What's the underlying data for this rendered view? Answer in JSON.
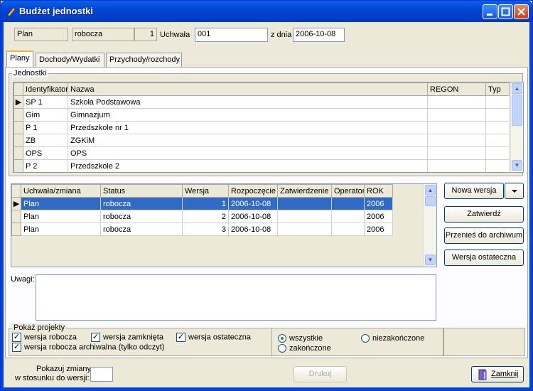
{
  "window": {
    "title": "Budżet jednostki"
  },
  "header": {
    "plan": "Plan",
    "state": "robocza",
    "version": "1",
    "uchwala_label": "Uchwała",
    "uchwala_value": "001",
    "date_label": "z dnia",
    "date_value": "2006-10-08"
  },
  "tabs": [
    "Plany",
    "Dochody/Wydatki",
    "Przychody/rozchody"
  ],
  "units": {
    "group_label": "Jednostki",
    "columns": [
      "Identyfikator",
      "Nazwa",
      "REGON",
      "Typ"
    ],
    "rows": [
      {
        "id": "SP 1",
        "name": "Szkoła Podstawowa",
        "regon": "",
        "typ": ""
      },
      {
        "id": "Gim",
        "name": "Gimnazjum",
        "regon": "",
        "typ": ""
      },
      {
        "id": "P 1",
        "name": "Przedszkole nr 1",
        "regon": "",
        "typ": ""
      },
      {
        "id": "ZB",
        "name": "ZGKiM",
        "regon": "",
        "typ": ""
      },
      {
        "id": "OPS",
        "name": "OPS",
        "regon": "",
        "typ": ""
      },
      {
        "id": "P 2",
        "name": "Przedszkole 2",
        "regon": "",
        "typ": ""
      }
    ]
  },
  "versions": {
    "columns": [
      "Uchwała/zmiana",
      "Status",
      "Wersja",
      "Rozpoczęcie",
      "Zatwierdzenie",
      "Operator",
      "ROK"
    ],
    "rows": [
      {
        "uchwala": "Plan",
        "status": "robocza",
        "wersja": "1",
        "start": "2006-10-08",
        "approved": "",
        "operator": "",
        "rok": "2006"
      },
      {
        "uchwala": "Plan",
        "status": "robocza",
        "wersja": "2",
        "start": "2006-10-08",
        "approved": "",
        "operator": "",
        "rok": "2006"
      },
      {
        "uchwala": "Plan",
        "status": "robocza",
        "wersja": "3",
        "start": "2006-10-08",
        "approved": "",
        "operator": "",
        "rok": "2006"
      }
    ]
  },
  "buttons": {
    "new_version": "Nowa wersja",
    "approve": "Zatwierdź",
    "archive": "Przenieś do archiwum",
    "final": "Wersja ostateczna",
    "print": "Drukuj",
    "close": "Zamknij"
  },
  "notes": {
    "label": "Uwagi:",
    "value": ""
  },
  "filters": {
    "group_label": "Pokaż projekty",
    "checkboxes": [
      {
        "label": "wersja robocza",
        "checked": true
      },
      {
        "label": "wersja zamknięta",
        "checked": true
      },
      {
        "label": "wersja ostateczna",
        "checked": true
      },
      {
        "label": "wersja robocza archiwalna (tylko odczyt)",
        "checked": true
      }
    ],
    "radios": [
      {
        "label": "wszystkie",
        "selected": true
      },
      {
        "label": "niezakończone",
        "selected": false
      },
      {
        "label": "zakończone",
        "selected": false
      }
    ]
  },
  "footer": {
    "changes_label_1": "Pokazuj zmiany",
    "changes_label_2": "w stosunku do wersji:",
    "changes_value": ""
  }
}
